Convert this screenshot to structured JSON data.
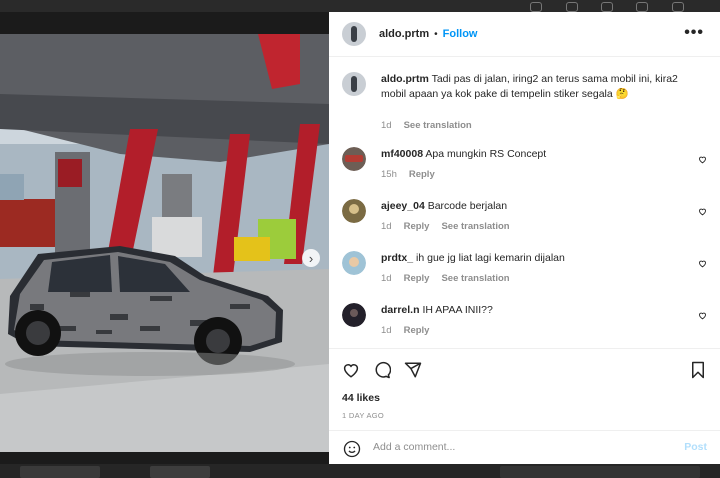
{
  "post": {
    "username": "aldo.prtm",
    "follow_label": "Follow",
    "more_label": "•••",
    "caption_user": "aldo.prtm",
    "caption_text": "Tadi pas di jalan, iring2 an terus sama mobil ini, kira2 mobil apaan ya kok pake di tempelin stiker segala 🤔",
    "caption_age": "1d",
    "caption_translate": "See translation",
    "likes": "44 likes",
    "posted": "1 DAY AGO"
  },
  "comments": [
    {
      "user": "mf40008",
      "text": "Apa mungkin RS Concept",
      "age": "15h",
      "reply": "Reply",
      "translate": ""
    },
    {
      "user": "ajeey_04",
      "text": "Barcode berjalan",
      "age": "1d",
      "reply": "Reply",
      "translate": "See translation"
    },
    {
      "user": "prdtx_",
      "text": "ih gue jg liat lagi kemarin dijalan",
      "age": "1d",
      "reply": "Reply",
      "translate": "See translation"
    },
    {
      "user": "darrel.n",
      "text": "IH APAA INII??",
      "age": "1d",
      "reply": "Reply",
      "translate": ""
    }
  ],
  "composer": {
    "placeholder": "Add a comment...",
    "post_label": "Post"
  },
  "media": {
    "next_glyph": "›",
    "slide_count": 3,
    "active_slide": 1
  },
  "icons": [
    "heart-icon",
    "comment-icon",
    "share-icon",
    "bookmark-icon",
    "emoji-icon",
    "more-icon"
  ],
  "colors": {
    "link": "#0095f6",
    "post_disabled": "#b2dffc",
    "muted": "#8e8e8e"
  }
}
